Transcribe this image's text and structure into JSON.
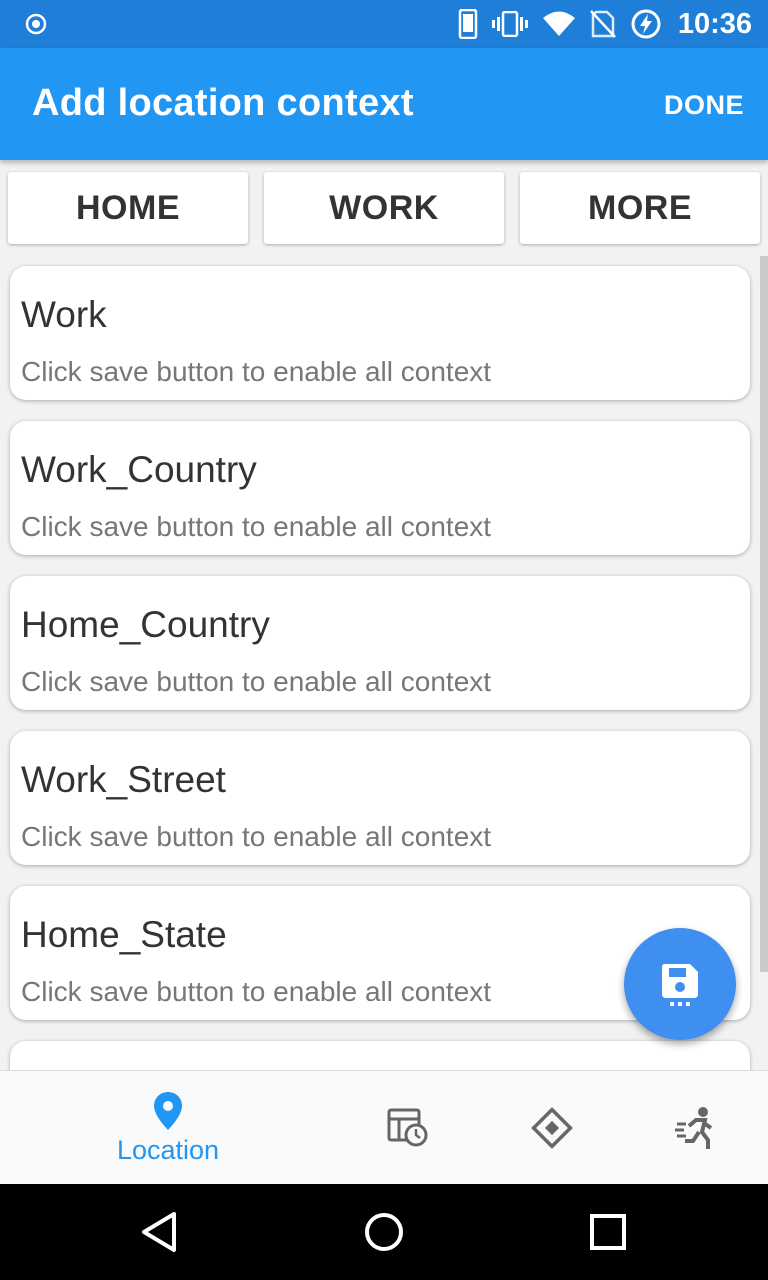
{
  "status_bar": {
    "time": "10:36",
    "icons": [
      "record-icon",
      "phone-icon",
      "vibrate-icon",
      "wifi-icon",
      "no-sim-icon",
      "charging-icon"
    ]
  },
  "app_bar": {
    "title": "Add location context",
    "done_label": "DONE",
    "color": "#2196f3"
  },
  "segments": [
    {
      "label": "HOME"
    },
    {
      "label": "WORK"
    },
    {
      "label": "MORE"
    }
  ],
  "contexts": [
    {
      "title": "Work",
      "subtitle": "Click save button to enable all context"
    },
    {
      "title": "Work_Country",
      "subtitle": "Click save button to enable all context"
    },
    {
      "title": "Home_Country",
      "subtitle": "Click save button to enable all context"
    },
    {
      "title": "Work_Street",
      "subtitle": "Click save button to enable all context"
    },
    {
      "title": "Home_State",
      "subtitle": "Click save button to enable all context"
    }
  ],
  "fab": {
    "icon": "save-icon",
    "color": "#3f8ff0"
  },
  "bottom_nav": {
    "items": [
      {
        "label": "Location",
        "icon": "location-pin-icon",
        "active": true
      },
      {
        "icon": "calendar-clock-icon"
      },
      {
        "icon": "diamond-direction-icon"
      },
      {
        "icon": "running-person-icon"
      }
    ]
  },
  "system_nav": [
    "back-icon",
    "home-icon",
    "recents-icon"
  ]
}
